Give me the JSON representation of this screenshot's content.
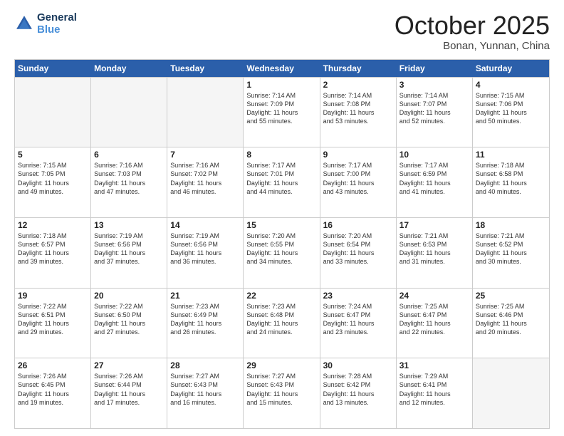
{
  "logo": {
    "line1": "General",
    "line2": "Blue"
  },
  "title": "October 2025",
  "location": "Bonan, Yunnan, China",
  "dayHeaders": [
    "Sunday",
    "Monday",
    "Tuesday",
    "Wednesday",
    "Thursday",
    "Friday",
    "Saturday"
  ],
  "weeks": [
    [
      {
        "num": "",
        "info": "",
        "empty": true
      },
      {
        "num": "",
        "info": "",
        "empty": true
      },
      {
        "num": "",
        "info": "",
        "empty": true
      },
      {
        "num": "1",
        "info": "Sunrise: 7:14 AM\nSunset: 7:09 PM\nDaylight: 11 hours\nand 55 minutes."
      },
      {
        "num": "2",
        "info": "Sunrise: 7:14 AM\nSunset: 7:08 PM\nDaylight: 11 hours\nand 53 minutes."
      },
      {
        "num": "3",
        "info": "Sunrise: 7:14 AM\nSunset: 7:07 PM\nDaylight: 11 hours\nand 52 minutes."
      },
      {
        "num": "4",
        "info": "Sunrise: 7:15 AM\nSunset: 7:06 PM\nDaylight: 11 hours\nand 50 minutes."
      }
    ],
    [
      {
        "num": "5",
        "info": "Sunrise: 7:15 AM\nSunset: 7:05 PM\nDaylight: 11 hours\nand 49 minutes."
      },
      {
        "num": "6",
        "info": "Sunrise: 7:16 AM\nSunset: 7:03 PM\nDaylight: 11 hours\nand 47 minutes."
      },
      {
        "num": "7",
        "info": "Sunrise: 7:16 AM\nSunset: 7:02 PM\nDaylight: 11 hours\nand 46 minutes."
      },
      {
        "num": "8",
        "info": "Sunrise: 7:17 AM\nSunset: 7:01 PM\nDaylight: 11 hours\nand 44 minutes."
      },
      {
        "num": "9",
        "info": "Sunrise: 7:17 AM\nSunset: 7:00 PM\nDaylight: 11 hours\nand 43 minutes."
      },
      {
        "num": "10",
        "info": "Sunrise: 7:17 AM\nSunset: 6:59 PM\nDaylight: 11 hours\nand 41 minutes."
      },
      {
        "num": "11",
        "info": "Sunrise: 7:18 AM\nSunset: 6:58 PM\nDaylight: 11 hours\nand 40 minutes."
      }
    ],
    [
      {
        "num": "12",
        "info": "Sunrise: 7:18 AM\nSunset: 6:57 PM\nDaylight: 11 hours\nand 39 minutes."
      },
      {
        "num": "13",
        "info": "Sunrise: 7:19 AM\nSunset: 6:56 PM\nDaylight: 11 hours\nand 37 minutes."
      },
      {
        "num": "14",
        "info": "Sunrise: 7:19 AM\nSunset: 6:56 PM\nDaylight: 11 hours\nand 36 minutes."
      },
      {
        "num": "15",
        "info": "Sunrise: 7:20 AM\nSunset: 6:55 PM\nDaylight: 11 hours\nand 34 minutes."
      },
      {
        "num": "16",
        "info": "Sunrise: 7:20 AM\nSunset: 6:54 PM\nDaylight: 11 hours\nand 33 minutes."
      },
      {
        "num": "17",
        "info": "Sunrise: 7:21 AM\nSunset: 6:53 PM\nDaylight: 11 hours\nand 31 minutes."
      },
      {
        "num": "18",
        "info": "Sunrise: 7:21 AM\nSunset: 6:52 PM\nDaylight: 11 hours\nand 30 minutes."
      }
    ],
    [
      {
        "num": "19",
        "info": "Sunrise: 7:22 AM\nSunset: 6:51 PM\nDaylight: 11 hours\nand 29 minutes."
      },
      {
        "num": "20",
        "info": "Sunrise: 7:22 AM\nSunset: 6:50 PM\nDaylight: 11 hours\nand 27 minutes."
      },
      {
        "num": "21",
        "info": "Sunrise: 7:23 AM\nSunset: 6:49 PM\nDaylight: 11 hours\nand 26 minutes."
      },
      {
        "num": "22",
        "info": "Sunrise: 7:23 AM\nSunset: 6:48 PM\nDaylight: 11 hours\nand 24 minutes."
      },
      {
        "num": "23",
        "info": "Sunrise: 7:24 AM\nSunset: 6:47 PM\nDaylight: 11 hours\nand 23 minutes."
      },
      {
        "num": "24",
        "info": "Sunrise: 7:25 AM\nSunset: 6:47 PM\nDaylight: 11 hours\nand 22 minutes."
      },
      {
        "num": "25",
        "info": "Sunrise: 7:25 AM\nSunset: 6:46 PM\nDaylight: 11 hours\nand 20 minutes."
      }
    ],
    [
      {
        "num": "26",
        "info": "Sunrise: 7:26 AM\nSunset: 6:45 PM\nDaylight: 11 hours\nand 19 minutes."
      },
      {
        "num": "27",
        "info": "Sunrise: 7:26 AM\nSunset: 6:44 PM\nDaylight: 11 hours\nand 17 minutes."
      },
      {
        "num": "28",
        "info": "Sunrise: 7:27 AM\nSunset: 6:43 PM\nDaylight: 11 hours\nand 16 minutes."
      },
      {
        "num": "29",
        "info": "Sunrise: 7:27 AM\nSunset: 6:43 PM\nDaylight: 11 hours\nand 15 minutes."
      },
      {
        "num": "30",
        "info": "Sunrise: 7:28 AM\nSunset: 6:42 PM\nDaylight: 11 hours\nand 13 minutes."
      },
      {
        "num": "31",
        "info": "Sunrise: 7:29 AM\nSunset: 6:41 PM\nDaylight: 11 hours\nand 12 minutes."
      },
      {
        "num": "",
        "info": "",
        "empty": true
      }
    ]
  ]
}
